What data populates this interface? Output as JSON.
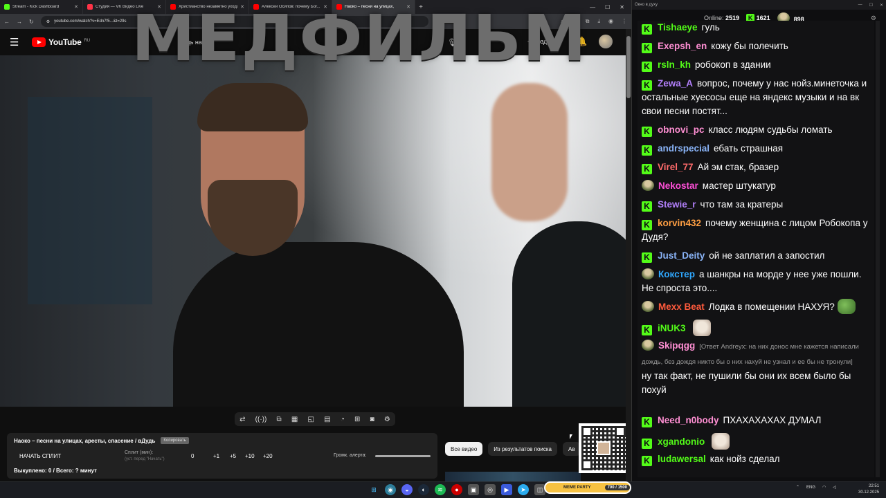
{
  "browser": {
    "tabs": [
      {
        "label": "Stream - Kick Dashboard",
        "color": "#53fc18",
        "active": false
      },
      {
        "label": "Студия — VK Видео Live",
        "color": "#ff3347",
        "active": false
      },
      {
        "label": "Христианство незаметно уходит",
        "color": "#ff0000",
        "active": false
      },
      {
        "label": "Алексей Осипов: почему Бог...",
        "color": "#ff0000",
        "active": false
      },
      {
        "label": "Наоко – песни на улицах,",
        "color": "#ff0000",
        "active": true
      }
    ],
    "new_tab": "+",
    "url": "youtube.com/watch?v=Edn7f5...&t=29s"
  },
  "youtube": {
    "logo_text": "YouTube",
    "region": "RU",
    "search_value": "дудь наоко",
    "create_label": "Создать",
    "overlay_title": "МЕДФИЛЬМ"
  },
  "player": {
    "controls": [
      "⇄",
      "((·))",
      "⧉",
      "▦",
      "◱",
      "▤",
      "◔",
      "⊞",
      "◙",
      "⚙"
    ]
  },
  "panel": {
    "title": "Наоко – песни на улицах, аресты, спасение / вДудь",
    "copy_label": "Копировать",
    "start_split": "НАЧАТЬ СПЛИТ",
    "split_label": "Сплит (мин):",
    "split_hint": "(уст. перед \"Начать\")",
    "split_value": "0",
    "plus_buttons": [
      "+1",
      "+5",
      "+10",
      "+20"
    ],
    "alert_label": "Громк. алерта:",
    "summary": "Выкуплено: 0 / Всего: ? минут"
  },
  "yt_tabs": [
    {
      "label": "Все видео",
      "selected": true
    },
    {
      "label": "Из результатов поиска",
      "selected": false
    },
    {
      "label": "Ав",
      "selected": false
    }
  ],
  "chat": {
    "window_title": "Окно в духу",
    "online_label": "Online:",
    "online_count": "2519",
    "kick_count": "1621",
    "other_count": "898",
    "messages": [
      {
        "badge": "k",
        "user": "Tishaeye",
        "color": "#53fc18",
        "text": "гуль"
      },
      {
        "badge": "k",
        "user": "Exepsh_en",
        "color": "#ff8fd3",
        "text": "кожу бы полечить"
      },
      {
        "badge": "k",
        "user": "rsln_kh",
        "color": "#53fc18",
        "text": "робокоп в здании"
      },
      {
        "badge": "k",
        "user": "Zewa_A",
        "color": "#b07ef8",
        "text": "вопрос, почему у нас нойз.минеточка и остальные хуесосы еще на яндекс музыки и на вк свои песни постят..."
      },
      {
        "badge": "k",
        "user": "obnovi_pc",
        "color": "#ff8fd3",
        "text": "класс людям судьбы ломать"
      },
      {
        "badge": "k",
        "user": "andrspecial",
        "color": "#8ab4f8",
        "text": "ебать страшная"
      },
      {
        "badge": "k",
        "user": "Virel_77",
        "color": "#ff6b6b",
        "text": "Ай эм стак, бразер"
      },
      {
        "badge": "av",
        "user": "Nekostar",
        "color": "#ff4fd8",
        "text": "мастер штукатур"
      },
      {
        "badge": "k",
        "user": "Stewie_r",
        "color": "#b07ef8",
        "text": "что там за кратеры"
      },
      {
        "badge": "k",
        "user": "korvin432",
        "color": "#ff9f43",
        "text": "почему женщина с лицом Робокопа у Дудя?"
      },
      {
        "badge": "k",
        "user": "Just_Deity",
        "color": "#8ab4f8",
        "text": "ой не заплатил а запостил"
      },
      {
        "badge": "av",
        "user": "Кокстер",
        "color": "#2fa8ff",
        "text": "а шанкры на морде у нее уже пошли. Не спроста это...."
      },
      {
        "badge": "av",
        "user": "Mexx Beat",
        "color": "#ff5a3c",
        "text": "Лодка в помещении НАХУЯ?",
        "emote": "frog"
      },
      {
        "badge": "k",
        "user": "iNUK3",
        "color": "#53fc18",
        "text": "",
        "emote": "cat"
      },
      {
        "badge": "av",
        "user": "Skipqgg",
        "color": "#ff8fd3",
        "reply": "[Ответ Andreyx: на них донос мне кажется написали дождь, без дождя никто бы о них нахуй не узнал и ее бы не тронули]",
        "text": "ну так факт, не пушили бы они их всем было бы похуй"
      },
      {
        "badge": "k",
        "user": "Need_n0body",
        "color": "#ff8fd3",
        "text": "ПХАХАХАХАХ ДУМАЛ"
      },
      {
        "badge": "k",
        "user": "xgandonio",
        "color": "#53fc18",
        "text": "",
        "emote": "cat"
      },
      {
        "badge": "k",
        "user": "ludawersal",
        "color": "#53fc18",
        "text": "как нойз сделал"
      }
    ]
  },
  "taskbar": {
    "meme_label": "MEME PARTY",
    "meme_progress": "700 / 1500",
    "lang": "ENG",
    "time": "22:51",
    "date": "30.12.2025"
  }
}
